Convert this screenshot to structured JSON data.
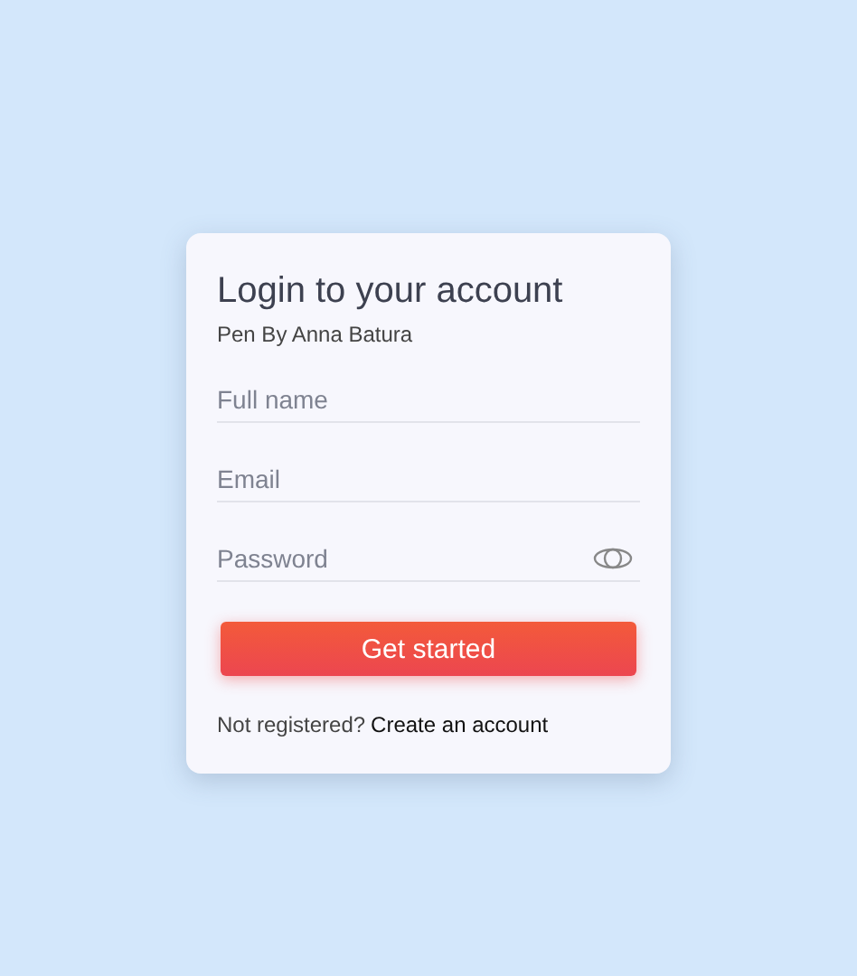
{
  "card": {
    "title": "Login to your account",
    "subtitle": "Pen By Anna Batura"
  },
  "fields": [
    {
      "kind": "text",
      "placeholder": "Full name"
    },
    {
      "kind": "text",
      "placeholder": "Email"
    },
    {
      "kind": "password",
      "placeholder": "Password"
    }
  ],
  "submit": {
    "label": "Get started"
  },
  "footer": {
    "prompt": "Not registered?",
    "link": "Create an account"
  }
}
